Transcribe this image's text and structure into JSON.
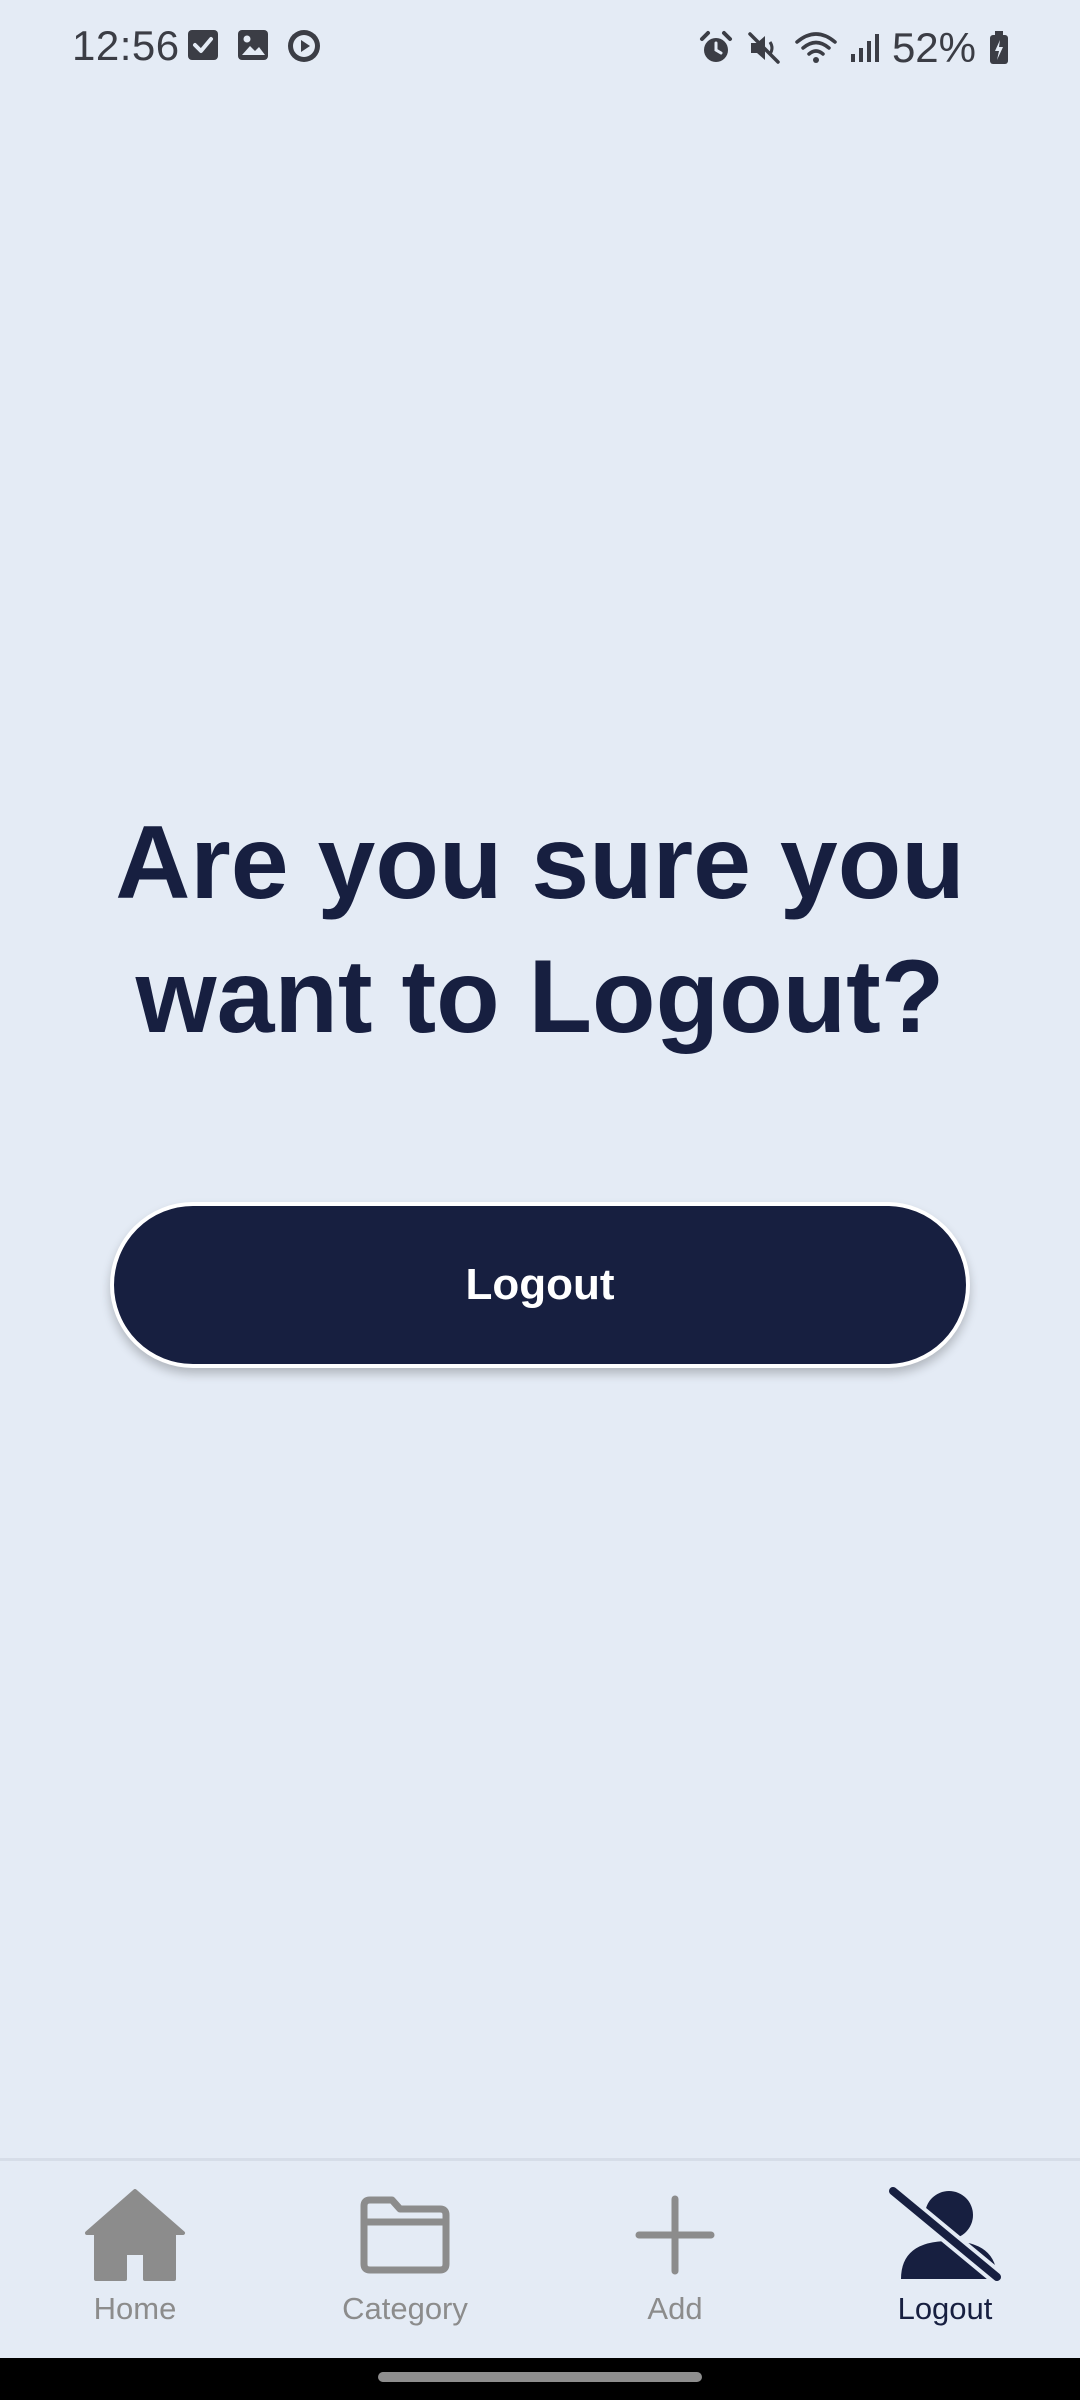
{
  "status_bar": {
    "time": "12:56",
    "battery_percent": "52%",
    "left_icons": [
      "checkbox-icon",
      "gallery-icon",
      "play-icon"
    ],
    "right_icons": [
      "alarm-icon",
      "mute-icon",
      "wifi-icon",
      "signal-icon",
      "battery-icon"
    ]
  },
  "main": {
    "prompt": "Are you sure you want to Logout?",
    "logout_button_label": "Logout"
  },
  "bottom_nav": {
    "active_tab": "Logout",
    "items": [
      {
        "label": "Home",
        "icon": "home-icon"
      },
      {
        "label": "Category",
        "icon": "folder-icon"
      },
      {
        "label": "Add",
        "icon": "plus-icon"
      },
      {
        "label": "Logout",
        "icon": "user-off-icon"
      }
    ]
  },
  "colors": {
    "background": "#e4ebf5",
    "primary": "#171f40",
    "inactive": "#8c8c8c",
    "button_text": "#ffffff"
  }
}
